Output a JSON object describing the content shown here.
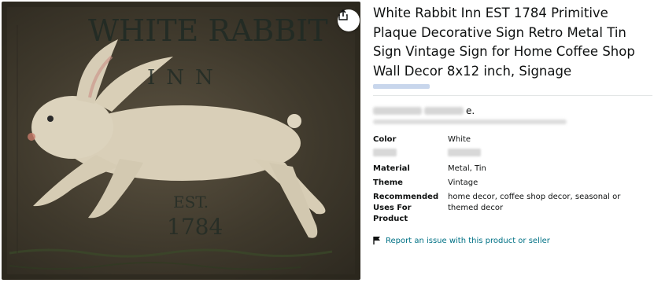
{
  "image": {
    "sign_line1": "WHITE RABBIT",
    "sign_line2": "INN",
    "sign_line3": "EST.",
    "sign_line4": "1784",
    "share_icon": "share-icon"
  },
  "product": {
    "title": "White Rabbit Inn EST 1784 Primitive Plaque Decorative Sign Retro Metal Tin Sign Vintage Sign for Home Coffee Shop Wall Decor 8x12 inch, Signage",
    "blurred_suffix": "e."
  },
  "specs": [
    {
      "key": "Color",
      "value": "White"
    },
    {
      "key": "",
      "value": ""
    },
    {
      "key": "Material",
      "value": "Metal, Tin"
    },
    {
      "key": "Theme",
      "value": "Vintage"
    },
    {
      "key": "Recommended Uses For Product",
      "value": "home decor, coffee shop decor, seasonal or themed decor"
    }
  ],
  "report": {
    "label": "Report an issue with this product or seller",
    "icon": "flag-icon"
  }
}
